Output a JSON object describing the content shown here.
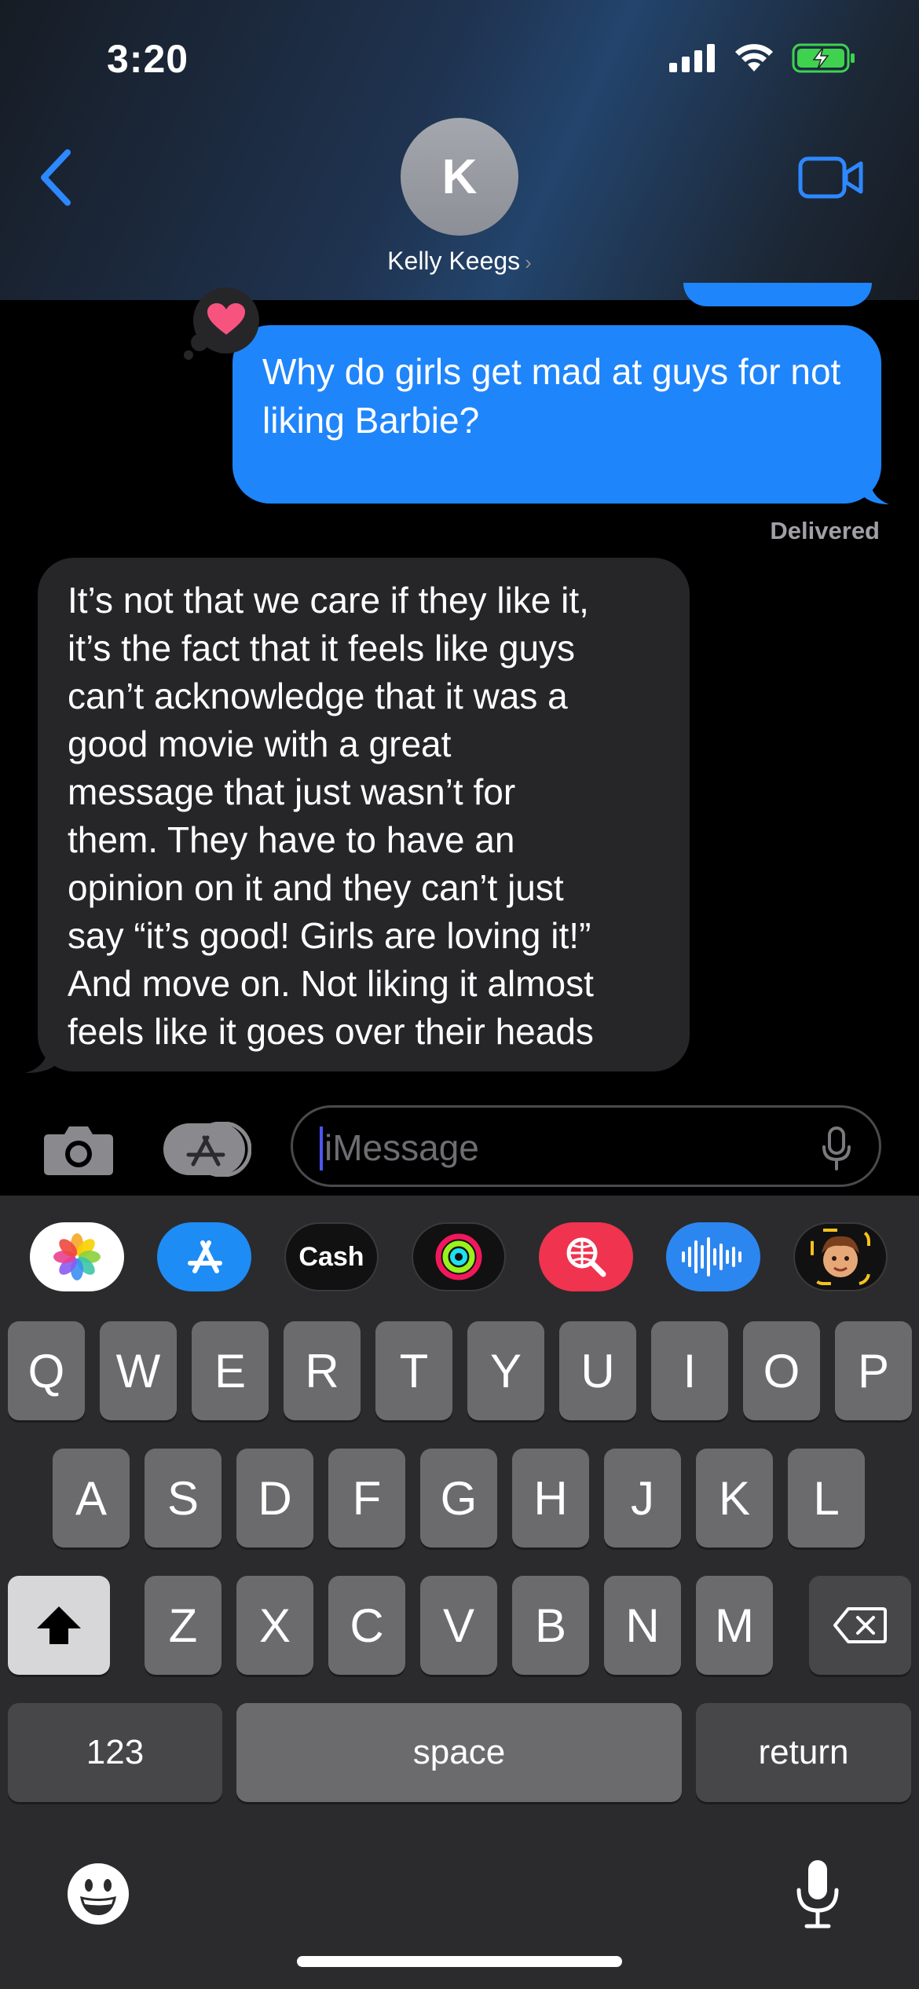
{
  "status_bar": {
    "time": "3:20"
  },
  "header": {
    "contact_initial": "K",
    "contact_name": "Kelly Keegs",
    "contact_chevron": "›"
  },
  "messages": {
    "outgoing": {
      "text": "Why do girls get mad at guys for not liking Barbie?",
      "status": "Delivered",
      "tapback_icon": "heart-icon"
    },
    "incoming": {
      "lines": [
        "It’s not that we care if they like it,",
        "it’s the fact that it feels like guys",
        "can’t acknowledge that it was a",
        "good movie with a great",
        "message that just wasn’t for",
        "them. They have to have an",
        "opinion on it and they can’t just",
        "say “it’s good! Girls are loving it!”",
        "And move on. Not liking it almost",
        "feels like it goes over their heads"
      ]
    }
  },
  "compose": {
    "placeholder": "iMessage"
  },
  "app_strip": [
    {
      "name": "photos-app-icon"
    },
    {
      "name": "app-store-icon"
    },
    {
      "name": "apple-cash-icon",
      "label": "Cash"
    },
    {
      "name": "activity-icon"
    },
    {
      "name": "image-search-icon"
    },
    {
      "name": "audio-message-icon"
    },
    {
      "name": "memoji-icon"
    }
  ],
  "keyboard": {
    "row1": [
      "Q",
      "W",
      "E",
      "R",
      "T",
      "Y",
      "U",
      "I",
      "O",
      "P"
    ],
    "row2": [
      "A",
      "S",
      "D",
      "F",
      "G",
      "H",
      "J",
      "K",
      "L"
    ],
    "row3": [
      "Z",
      "X",
      "C",
      "V",
      "B",
      "N",
      "M"
    ],
    "numbers": "123",
    "space": "space",
    "return": "return"
  },
  "colors": {
    "accent": "#1f85fb",
    "incoming_bubble": "#262629",
    "tapback_heart": "#f7537f"
  }
}
